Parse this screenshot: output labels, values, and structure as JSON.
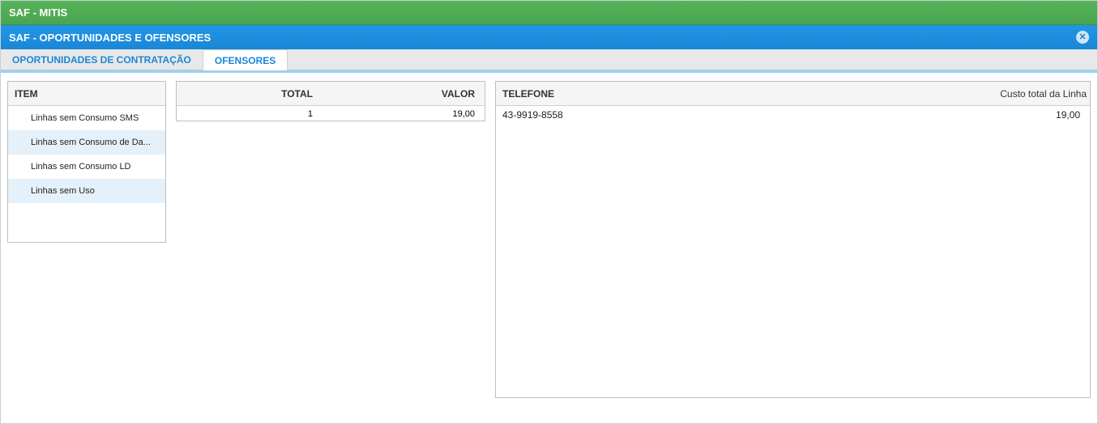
{
  "header": {
    "app_title": "SAF - MITIS",
    "section_title": "SAF - OPORTUNIDADES E OFENSORES"
  },
  "tabs": {
    "inactive": "OPORTUNIDADES DE CONTRATAÇÃO",
    "active": "OFENSORES"
  },
  "items_panel": {
    "header": "ITEM",
    "rows": [
      {
        "label": "Linhas sem Consumo SMS"
      },
      {
        "label": "Linhas sem Consumo de Da..."
      },
      {
        "label": "Linhas sem Consumo LD"
      },
      {
        "label": "Linhas sem Uso"
      }
    ]
  },
  "totals_panel": {
    "col_total": "TOTAL",
    "col_valor": "VALOR",
    "total_value": "1",
    "valor_value": "19,00"
  },
  "phones_panel": {
    "col_tel": "TELEFONE",
    "col_cost": "Custo total da Linha",
    "rows": [
      {
        "telefone": "43-9919-8558",
        "custo": "19,00"
      }
    ]
  }
}
